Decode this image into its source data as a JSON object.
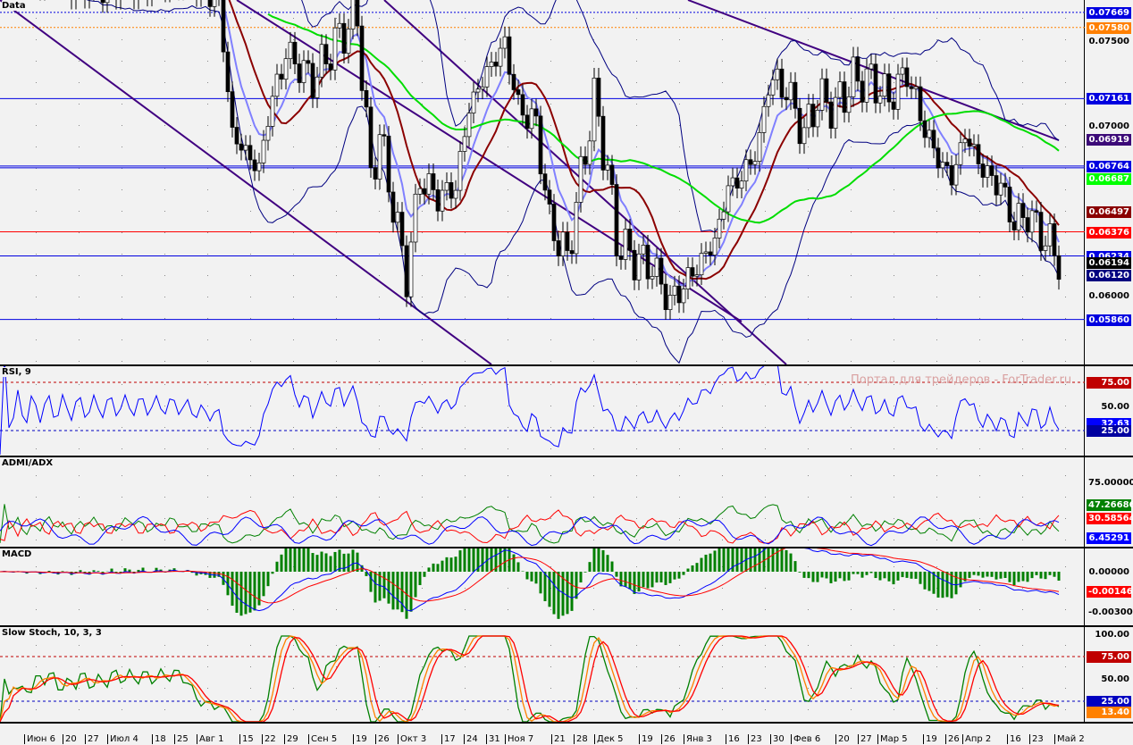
{
  "panels": {
    "main": "Data",
    "rsi": "RSI, 9",
    "adx": "ADMI/ADX",
    "macd": "MACD",
    "stoch": "Slow Stoch, 10, 3, 3"
  },
  "watermark": "Портал для трейдеров - ForTrader.ru",
  "price_axis": {
    "ticks": [
      "0.07500",
      "0.07000",
      "0.06000"
    ],
    "tags": [
      {
        "v": "0.07669",
        "c": "#0000e0"
      },
      {
        "v": "0.07580",
        "c": "#ff8000"
      },
      {
        "v": "0.07161",
        "c": "#0000e0"
      },
      {
        "v": "0.06919",
        "c": "#3c0a78"
      },
      {
        "v": "0.06764",
        "c": "#0000e0"
      },
      {
        "v": "0.06687",
        "c": "#00ff00"
      },
      {
        "v": "0.06497",
        "c": "#8b0000"
      },
      {
        "v": "0.06376",
        "c": "#ff0000"
      },
      {
        "v": "0.06234",
        "c": "#0000e0"
      },
      {
        "v": "0.06194",
        "c": "#000000"
      },
      {
        "v": "0.06120",
        "c": "#000080"
      },
      {
        "v": "0.05860",
        "c": "#0000e0"
      }
    ]
  },
  "rsi_axis": {
    "ticks": [
      "50.00"
    ],
    "tags": [
      {
        "v": "75.00",
        "c": "#c00000"
      },
      {
        "v": "32.63",
        "c": "#0000ff"
      },
      {
        "v": "25.00",
        "c": "#0000a0"
      }
    ]
  },
  "adx_axis": {
    "ticks": [
      "75.00000"
    ],
    "tags": [
      {
        "v": "47.26686",
        "c": "#008000"
      },
      {
        "v": "30.58564",
        "c": "#ff0000"
      },
      {
        "v": "6.45291",
        "c": "#0000ff"
      }
    ]
  },
  "macd_axis": {
    "ticks": [
      "0.00000",
      "-0.00300"
    ],
    "tags": [
      {
        "v": "-0.00146",
        "c": "#ff0000"
      }
    ]
  },
  "stoch_axis": {
    "ticks": [
      "100.00",
      "50.00"
    ],
    "tags": [
      {
        "v": "75.00",
        "c": "#c00000"
      },
      {
        "v": "25.00",
        "c": "#0000c0"
      },
      {
        "v": "13.40",
        "c": "#ff8000"
      }
    ]
  },
  "dates": [
    "Июн 6",
    "20",
    "27",
    "Июл 4",
    "18",
    "25",
    "Авг 1",
    "15",
    "22",
    "29",
    "Сен 5",
    "19",
    "26",
    "Окт 3",
    "17",
    "24",
    "31",
    "Ноя 7",
    "21",
    "28",
    "Дек 5",
    "19",
    "26",
    "Янв 3",
    "16",
    "23",
    "30",
    "Фев 6",
    "20",
    "27",
    "Мар 5",
    "19",
    "26",
    "Апр 2",
    "16",
    "23",
    "Май 2"
  ],
  "chart_data": {
    "type": "line",
    "title": "Data",
    "ylim": [
      0.0555,
      0.0777
    ],
    "close_approx": [
      0.079,
      0.0785,
      0.079,
      0.0775,
      0.0774,
      0.0695,
      0.0674,
      0.0706,
      0.0743,
      0.0727,
      0.0753,
      0.0764,
      0.0669,
      0.0695,
      0.0653,
      0.0611,
      0.0669,
      0.0658,
      0.0664,
      0.0711,
      0.0732,
      0.0748,
      0.0711,
      0.0701,
      0.0643,
      0.0622,
      0.0685,
      0.0716,
      0.0674,
      0.0632,
      0.0622,
      0.0617,
      0.0596,
      0.0606,
      0.0617,
      0.0632,
      0.0664,
      0.0669,
      0.069,
      0.0727,
      0.0722,
      0.0695,
      0.0716,
      0.0711,
      0.0727,
      0.0727,
      0.0716,
      0.0732,
      0.0706,
      0.0685,
      0.0669,
      0.0695,
      0.0674,
      0.0664,
      0.0643,
      0.0648,
      0.0637,
      0.0622
    ],
    "levels": [
      0.07669,
      0.0758,
      0.07161,
      0.06764,
      0.06376,
      0.06234,
      0.0586
    ],
    "colors": {
      "price": "#000000",
      "ma_fast": "#8b0000",
      "ma_slow": "#00dd00",
      "bands": "#000080",
      "mid": "#8080ff",
      "channel": "#400080"
    }
  }
}
